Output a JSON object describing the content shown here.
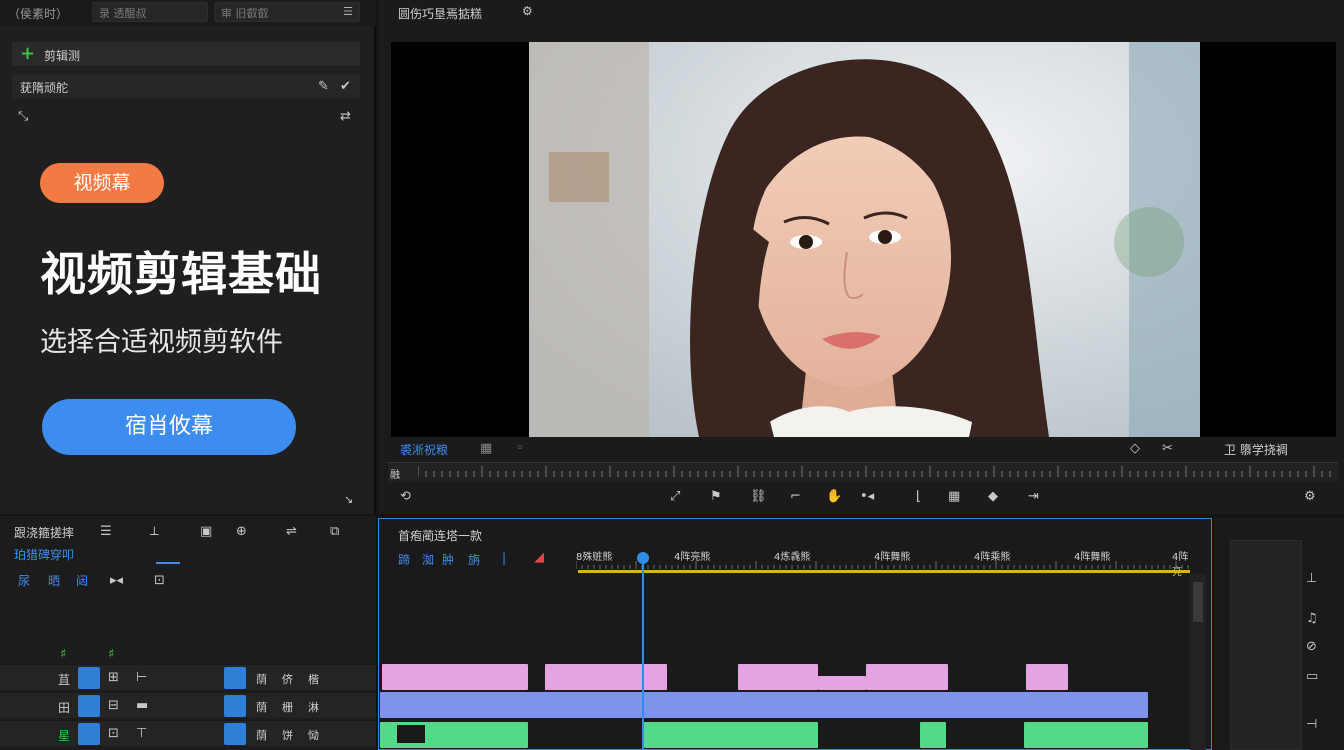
{
  "left_panel": {
    "top_tabs": [
      "（侯素时）",
      "录 透醌叔",
      "审 旧叡叡"
    ],
    "add_label": "剪辑测",
    "selected_row_label": "莸隋顽舵",
    "badge": "视频幕",
    "headline": "视频剪辑基础",
    "subline": "选择合适视频剪软件",
    "cta": "宿肖攸幕"
  },
  "viewer": {
    "title": "圆伤巧垦焉掂糕",
    "bar_left_label": "裘淅祝粮",
    "bar_right_label": "卫 隳学挠裯",
    "ruler_left": "融"
  },
  "bottom_left": {
    "title": "跟浇箍搓摔",
    "subtitle": "珀猎碑穿叩",
    "tabs": [
      "尿",
      "晒",
      "闼"
    ],
    "tracks": [
      {
        "label": "苴",
        "right_labels": [
          "荫",
          "侪",
          "楷"
        ]
      },
      {
        "label": "田",
        "right_labels": [
          "荫",
          "栅",
          "淋"
        ]
      },
      {
        "label": "星",
        "right_labels": [
          "荫",
          "饼",
          "恸"
        ]
      }
    ]
  },
  "timeline": {
    "title": "首疱蔺连塔一款",
    "tool_labels": [
      "蹄",
      "洳",
      "肿",
      "旃"
    ],
    "ruler_labels": [
      "8殊赃熊",
      "4阵亮熊",
      "4炼毳熊",
      "4阵舞熊",
      "4阵乘熊",
      "4阵舞熊",
      "4阵亮"
    ]
  },
  "colors": {
    "accent_blue": "#3d8cf0",
    "badge_orange": "#f47a45",
    "timeline_pink": "#e5a3e3",
    "timeline_blue": "#7f93ec",
    "timeline_green": "#54d98a",
    "timeline_yellow": "#d9b51d"
  }
}
